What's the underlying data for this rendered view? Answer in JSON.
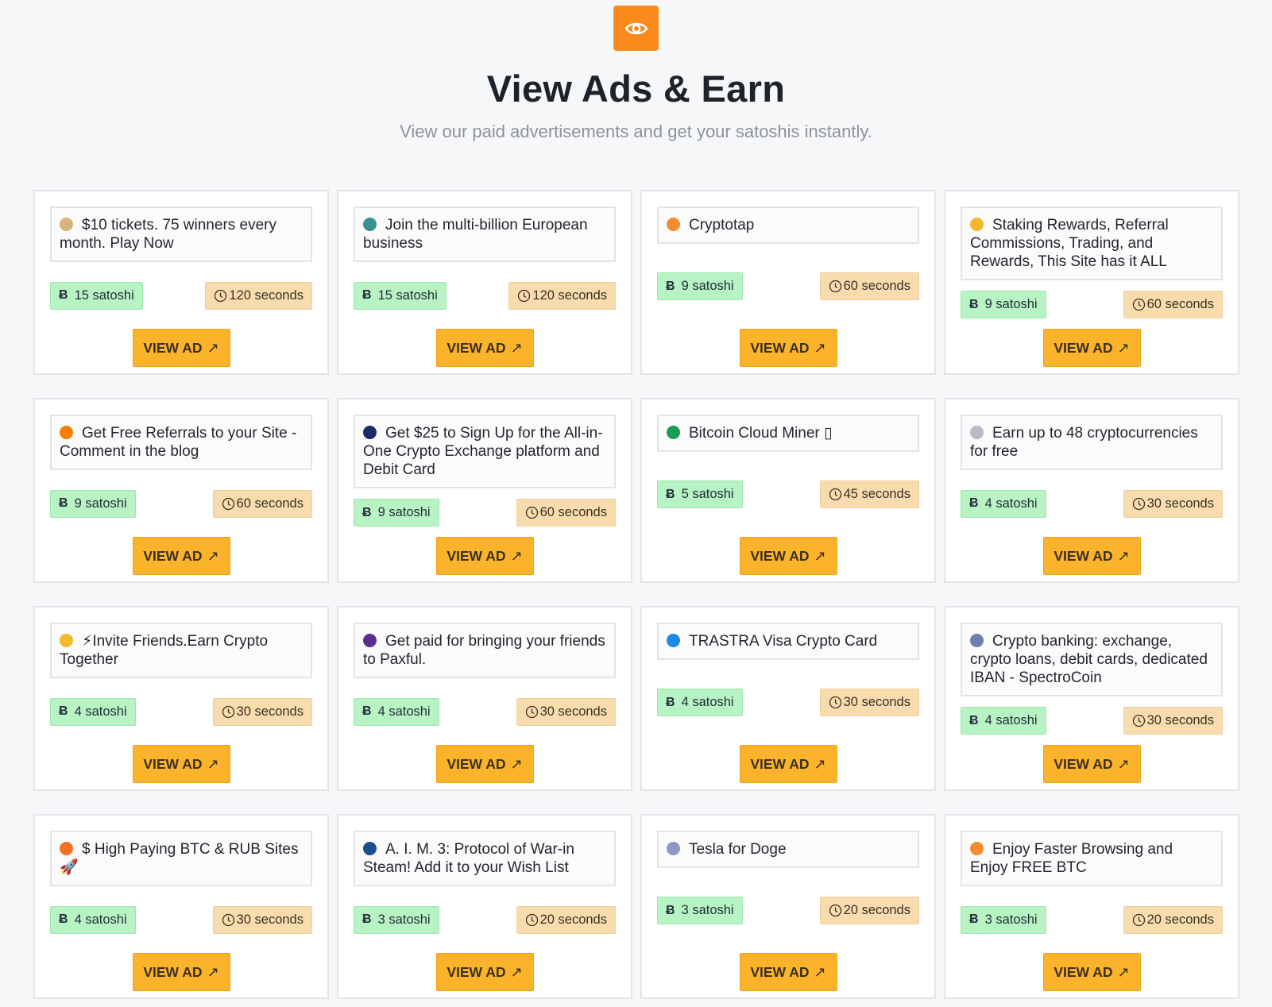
{
  "header": {
    "icon": "eye-icon",
    "title": "View Ads & Earn",
    "subtitle": "View our paid advertisements and get your satoshis instantly."
  },
  "colors": {
    "accent": "#fb8a1d",
    "button": "#fbb32b",
    "satoshi_badge": "#b7f3c3",
    "time_badge": "#f9dcae"
  },
  "ads": [
    {
      "title": "$10 tickets. 75 winners every month. Play Now",
      "icon": "ticket-icon",
      "icon_color": "#d8b37a",
      "satoshi": "15 satoshi",
      "seconds": "120 seconds",
      "button": "VIEW AD"
    },
    {
      "title": "Join the multi-billion European business",
      "icon": "globe-icon",
      "icon_color": "#3a8f8f",
      "satoshi": "15 satoshi",
      "seconds": "120 seconds",
      "button": "VIEW AD"
    },
    {
      "title": "Cryptotap",
      "icon": "cryptotap-logo-icon",
      "icon_color": "#f28c2c",
      "satoshi": "9 satoshi",
      "seconds": "60 seconds",
      "button": "VIEW AD"
    },
    {
      "title": "Staking Rewards, Referral Commissions, Trading, and Rewards, This Site has it ALL",
      "icon": "binance-diamond-icon",
      "icon_color": "#f3ba2f",
      "satoshi": "9 satoshi",
      "seconds": "60 seconds",
      "button": "VIEW AD"
    },
    {
      "title": "Get Free Referrals to your Site - Comment in the blog",
      "icon": "blogger-icon",
      "icon_color": "#f57d00",
      "satoshi": "9 satoshi",
      "seconds": "60 seconds",
      "button": "VIEW AD"
    },
    {
      "title": "Get $25 to Sign Up for the All-in-One Crypto Exchange platform and Debit Card",
      "icon": "crypto-exchange-icon",
      "icon_color": "#1b2a6b",
      "satoshi": "9 satoshi",
      "seconds": "60 seconds",
      "button": "VIEW AD"
    },
    {
      "title": "Bitcoin Cloud Miner ▯",
      "icon": "cloud-miner-icon",
      "icon_color": "#1a9b57",
      "satoshi": "5 satoshi",
      "seconds": "45 seconds",
      "button": "VIEW AD"
    },
    {
      "title": "Earn up to 48 cryptocurrencies for free",
      "icon": "network-icon",
      "icon_color": "#b8bcc4",
      "satoshi": "4 satoshi",
      "seconds": "30 seconds",
      "button": "VIEW AD"
    },
    {
      "title": "⚡Invite Friends.Earn Crypto Together",
      "icon": "binance-diamond-icon",
      "icon_color": "#f3ba2f",
      "satoshi": "4 satoshi",
      "seconds": "30 seconds",
      "button": "VIEW AD"
    },
    {
      "title": "Get paid for bringing your friends to Paxful.",
      "icon": "paxful-icon",
      "icon_color": "#5a2d91",
      "satoshi": "4 satoshi",
      "seconds": "30 seconds",
      "button": "VIEW AD"
    },
    {
      "title": "TRASTRA Visa Crypto Card",
      "icon": "trastra-logo-icon",
      "icon_color": "#1e88e5",
      "satoshi": "4 satoshi",
      "seconds": "30 seconds",
      "button": "VIEW AD"
    },
    {
      "title": "Crypto banking: exchange, crypto loans, debit cards, dedicated IBAN - SpectroCoin",
      "icon": "spectrocoin-icon",
      "icon_color": "#6f7fae",
      "satoshi": "4 satoshi",
      "seconds": "30 seconds",
      "button": "VIEW AD"
    },
    {
      "title": "$ High Paying BTC & RUB Sites 🚀",
      "icon": "coin-icon",
      "icon_color": "#f36f21",
      "satoshi": "4 satoshi",
      "seconds": "30 seconds",
      "button": "VIEW AD"
    },
    {
      "title": "A. I. M. 3: Protocol of War-in Steam! Add it to your Wish List",
      "icon": "steam-icon",
      "icon_color": "#1b4f8a",
      "satoshi": "3 satoshi",
      "seconds": "20 seconds",
      "button": "VIEW AD"
    },
    {
      "title": "Tesla for Doge",
      "icon": "globe-outline-icon",
      "icon_color": "#8c98c8",
      "satoshi": "3 satoshi",
      "seconds": "20 seconds",
      "button": "VIEW AD"
    },
    {
      "title": "Enjoy Faster Browsing and Enjoy FREE BTC",
      "icon": "cryptotab-icon",
      "icon_color": "#f28c2c",
      "satoshi": "3 satoshi",
      "seconds": "20 seconds",
      "button": "VIEW AD"
    }
  ]
}
